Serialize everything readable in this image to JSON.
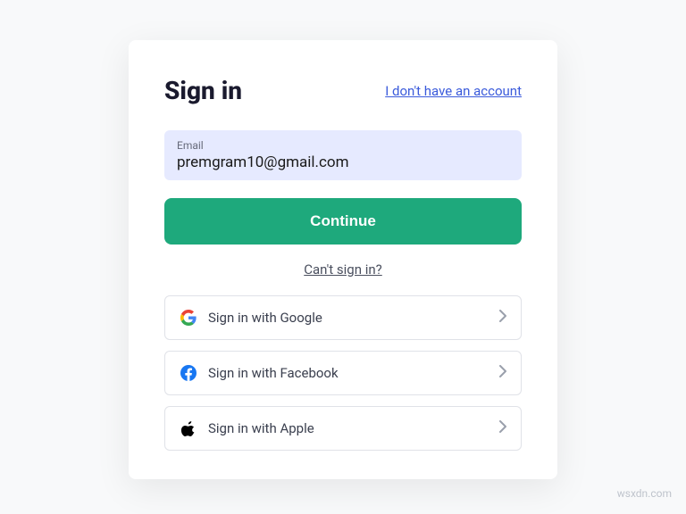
{
  "header": {
    "title": "Sign in",
    "no_account_link": "I don't have an account"
  },
  "email": {
    "label": "Email",
    "value": "premgram10@gmail.com"
  },
  "buttons": {
    "continue": "Continue",
    "cant_signin": "Can't sign in?"
  },
  "social": {
    "google": "Sign in with Google",
    "facebook": "Sign in with Facebook",
    "apple": "Sign in with Apple"
  },
  "watermark": "wsxdn.com"
}
